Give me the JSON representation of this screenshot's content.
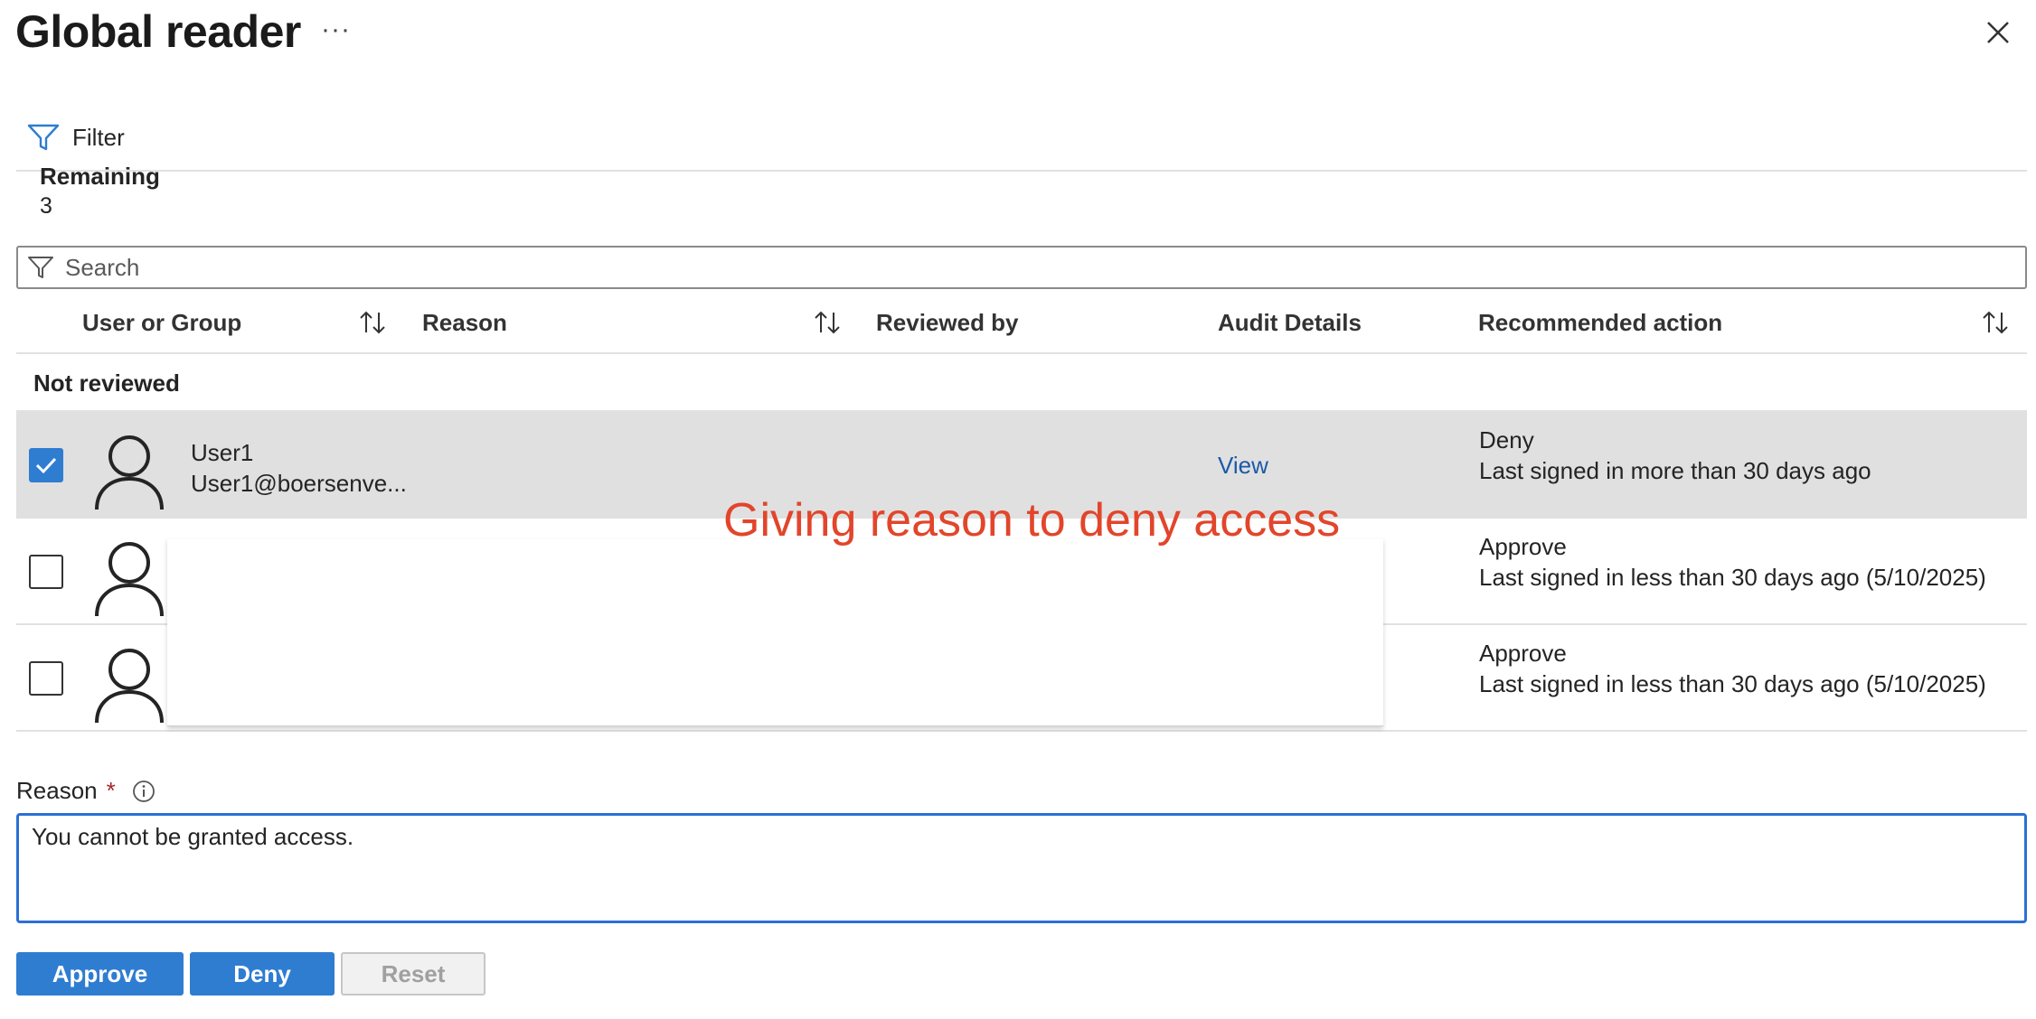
{
  "header": {
    "title": "Global reader",
    "more_label": "···"
  },
  "toolbar": {
    "filter_label": "Filter"
  },
  "summary": {
    "remaining_label": "Remaining",
    "remaining_value": "3"
  },
  "search": {
    "placeholder": "Search"
  },
  "table": {
    "columns": [
      "User or Group",
      "Reason",
      "Reviewed by",
      "Audit Details",
      "Recommended action"
    ],
    "group_label": "Not reviewed",
    "rows": [
      {
        "selected": true,
        "name": "User1",
        "email": "User1@boersenve...",
        "audit_link": "View",
        "recommended_action": "Deny",
        "recommended_detail": "Last signed in more than 30 days ago"
      },
      {
        "selected": false,
        "name": "",
        "email": "",
        "audit_link": "",
        "recommended_action": "Approve",
        "recommended_detail": "Last signed in less than 30 days ago (5/10/2025)"
      },
      {
        "selected": false,
        "name": "",
        "email": "",
        "audit_link": "",
        "recommended_action": "Approve",
        "recommended_detail": "Last signed in less than 30 days ago (5/10/2025)"
      }
    ]
  },
  "annotation": "Giving reason to deny access",
  "reason": {
    "label": "Reason",
    "required_marker": "*",
    "value": "You cannot be granted access."
  },
  "actions": {
    "approve_label": "Approve",
    "deny_label": "Deny",
    "reset_label": "Reset"
  },
  "colors": {
    "accent": "#2f7dd1",
    "link": "#1a5aa8",
    "annotation": "#e2452b",
    "selected_row": "#e0e0e0"
  },
  "icons": [
    "more-icon",
    "close-icon",
    "filter-icon",
    "sort-icon",
    "checkbox-icon",
    "person-icon",
    "info-icon"
  ]
}
